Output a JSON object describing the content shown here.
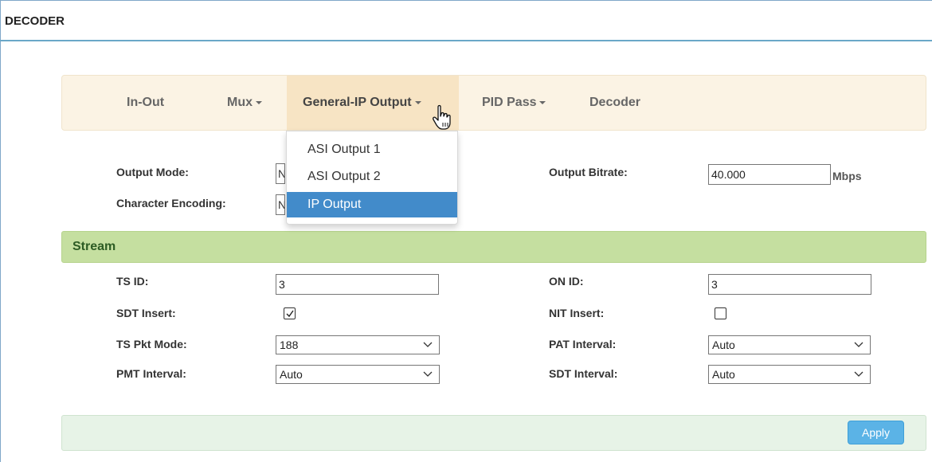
{
  "app": {
    "title": "DECODER"
  },
  "nav": {
    "items": [
      {
        "label": "In-Out",
        "dropdown": false,
        "active": false
      },
      {
        "label": "Mux",
        "dropdown": true,
        "active": false
      },
      {
        "label": "General-IP Output",
        "dropdown": true,
        "active": true
      },
      {
        "label": "PID Pass",
        "dropdown": true,
        "active": false
      },
      {
        "label": "Decoder",
        "dropdown": false,
        "active": false
      }
    ],
    "open_menu": {
      "items": [
        "ASI Output 1",
        "ASI Output 2",
        "IP Output"
      ],
      "highlighted": "IP Output"
    }
  },
  "output": {
    "mode_label": "Output Mode:",
    "mode_value_fragment": "N",
    "encoding_label": "Character Encoding:",
    "encoding_value_fragment": "N",
    "bitrate_label": "Output Bitrate:",
    "bitrate_value": "40.000",
    "bitrate_unit": "Mbps"
  },
  "stream": {
    "header": "Stream",
    "ts_id_label": "TS ID:",
    "ts_id_value": "3",
    "on_id_label": "ON ID:",
    "on_id_value": "3",
    "sdt_insert_label": "SDT Insert:",
    "sdt_insert_checked": true,
    "nit_insert_label": "NIT Insert:",
    "nit_insert_checked": false,
    "ts_pkt_mode_label": "TS Pkt Mode:",
    "ts_pkt_mode_value": "188",
    "pat_interval_label": "PAT Interval:",
    "pat_interval_value": "Auto",
    "pmt_interval_label": "PMT Interval:",
    "pmt_interval_value": "Auto",
    "sdt_interval_label": "SDT Interval:",
    "sdt_interval_value": "Auto"
  },
  "footer": {
    "apply_label": "Apply"
  },
  "colors": {
    "navbar_bg": "#fbf3e4",
    "nav_active_bg": "#f7e4c4",
    "menu_highlight": "#428bca",
    "stream_header_bg": "#c5dfa0",
    "footer_bg": "#e7f3e7",
    "apply_button": "#5bb3e6"
  }
}
